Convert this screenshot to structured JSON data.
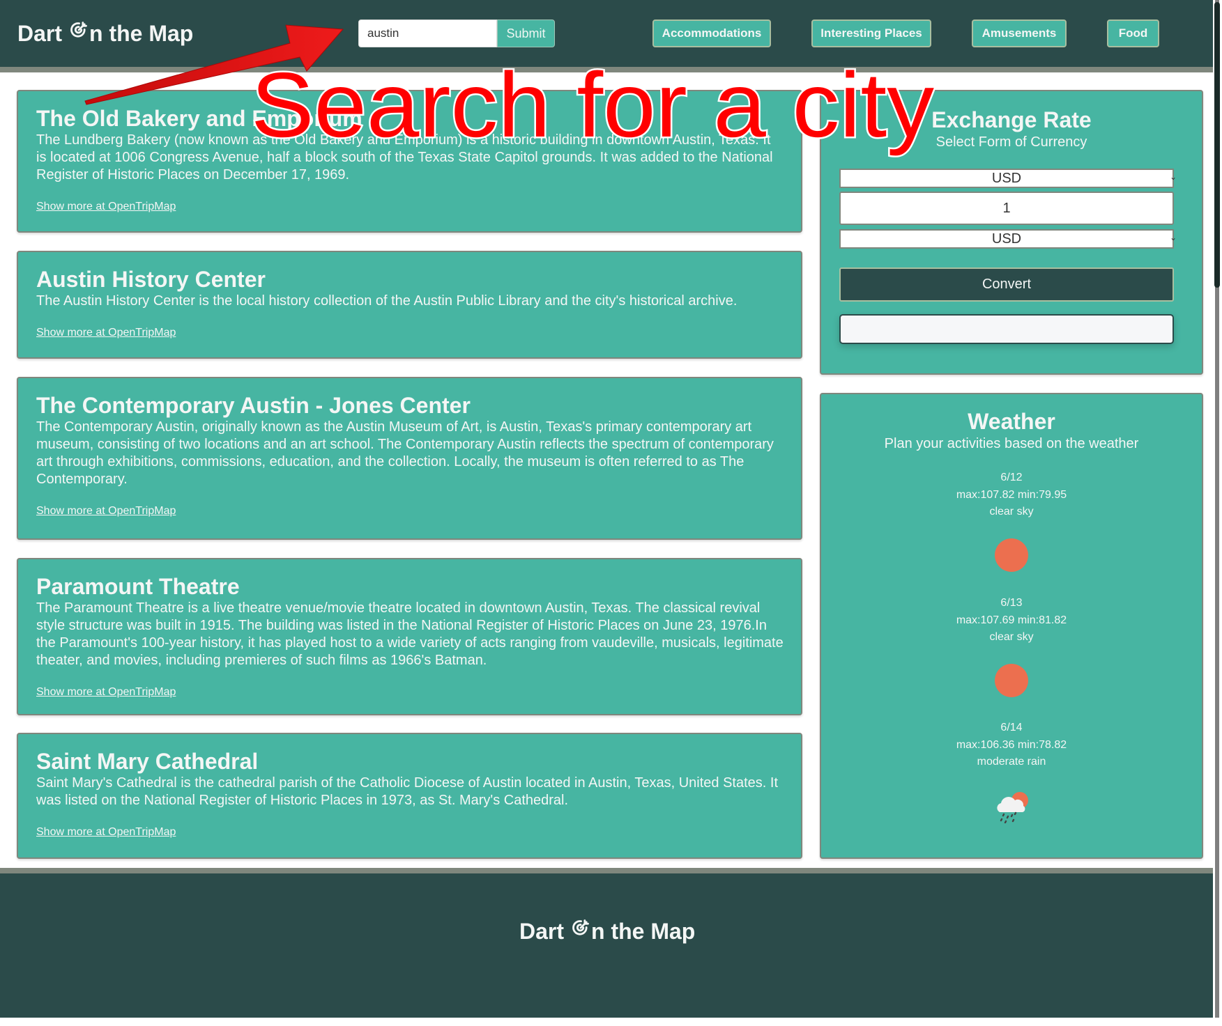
{
  "header": {
    "logo_prefix": "Dart",
    "logo_suffix": "n the Map",
    "logo_icon": "dart-target-icon",
    "search": {
      "value": "austin",
      "placeholder": ""
    },
    "submit_label": "Submit",
    "nav": [
      {
        "label": "Accommodations"
      },
      {
        "label": "Interesting Places"
      },
      {
        "label": "Amusements"
      },
      {
        "label": "Food"
      }
    ]
  },
  "places": [
    {
      "title": "The Old Bakery and Emporium",
      "description": "The Lundberg Bakery (now known as the Old Bakery and Emporium) is a historic building in downtown Austin, Texas. It is located at 1006 Congress Avenue, half a block south of the Texas State Capitol grounds. It was added to the National Register of Historic Places on December 17, 1969.",
      "link": "Show more at OpenTripMap"
    },
    {
      "title": "Austin History Center",
      "description": "The Austin History Center is the local history collection of the Austin Public Library and the city's historical archive.",
      "link": "Show more at OpenTripMap"
    },
    {
      "title": "The Contemporary Austin - Jones Center",
      "description": "The Contemporary Austin, originally known as the Austin Museum of Art, is Austin, Texas's primary contemporary art museum, consisting of two locations and an art school. The Contemporary Austin reflects the spectrum of contemporary art through exhibitions, commissions, education, and the collection. Locally, the museum is often referred to as The Contemporary.",
      "link": "Show more at OpenTripMap"
    },
    {
      "title": "Paramount Theatre",
      "description": "The Paramount Theatre is a live theatre venue/movie theatre located in downtown Austin, Texas. The classical revival style structure was built in 1915. The building was listed in the National Register of Historic Places on June 23, 1976.In the Paramount's 100-year history, it has played host to a wide variety of acts ranging from vaudeville, musicals, legitimate theater, and movies, including premieres of such films as 1966's Batman.",
      "link": "Show more at OpenTripMap"
    },
    {
      "title": "Saint Mary Cathedral",
      "description": "Saint Mary's Cathedral is the cathedral parish of the Catholic Diocese of Austin located in Austin, Texas, United States. It was listed on the National Register of Historic Places in 1973, as St. Mary's Cathedral.",
      "link": "Show more at OpenTripMap"
    }
  ],
  "exchange": {
    "title": "Exchange Rate",
    "subtitle": "Select Form of Currency",
    "from_currency": "USD",
    "amount": "1",
    "to_currency": "USD",
    "convert_label": "Convert",
    "result": ""
  },
  "weather": {
    "title": "Weather",
    "subtitle": "Plan your activities based on the weather",
    "days": [
      {
        "date": "6/12",
        "temps": "max:107.82 min:79.95",
        "condition": "clear sky",
        "icon": "sun-icon"
      },
      {
        "date": "6/13",
        "temps": "max:107.69 min:81.82",
        "condition": "clear sky",
        "icon": "sun-icon"
      },
      {
        "date": "6/14",
        "temps": "max:106.36 min:78.82",
        "condition": "moderate rain",
        "icon": "rain-cloud-icon"
      }
    ]
  },
  "footer": {
    "logo_prefix": "Dart",
    "logo_suffix": "n the Map"
  },
  "annotation": {
    "text": "Search for a city",
    "color": "#ff0000"
  },
  "colors": {
    "header_bg": "#2b4b4a",
    "card_bg": "#47b5a2",
    "accent_sun": "#ec6f4f",
    "divider": "#7f877d"
  }
}
